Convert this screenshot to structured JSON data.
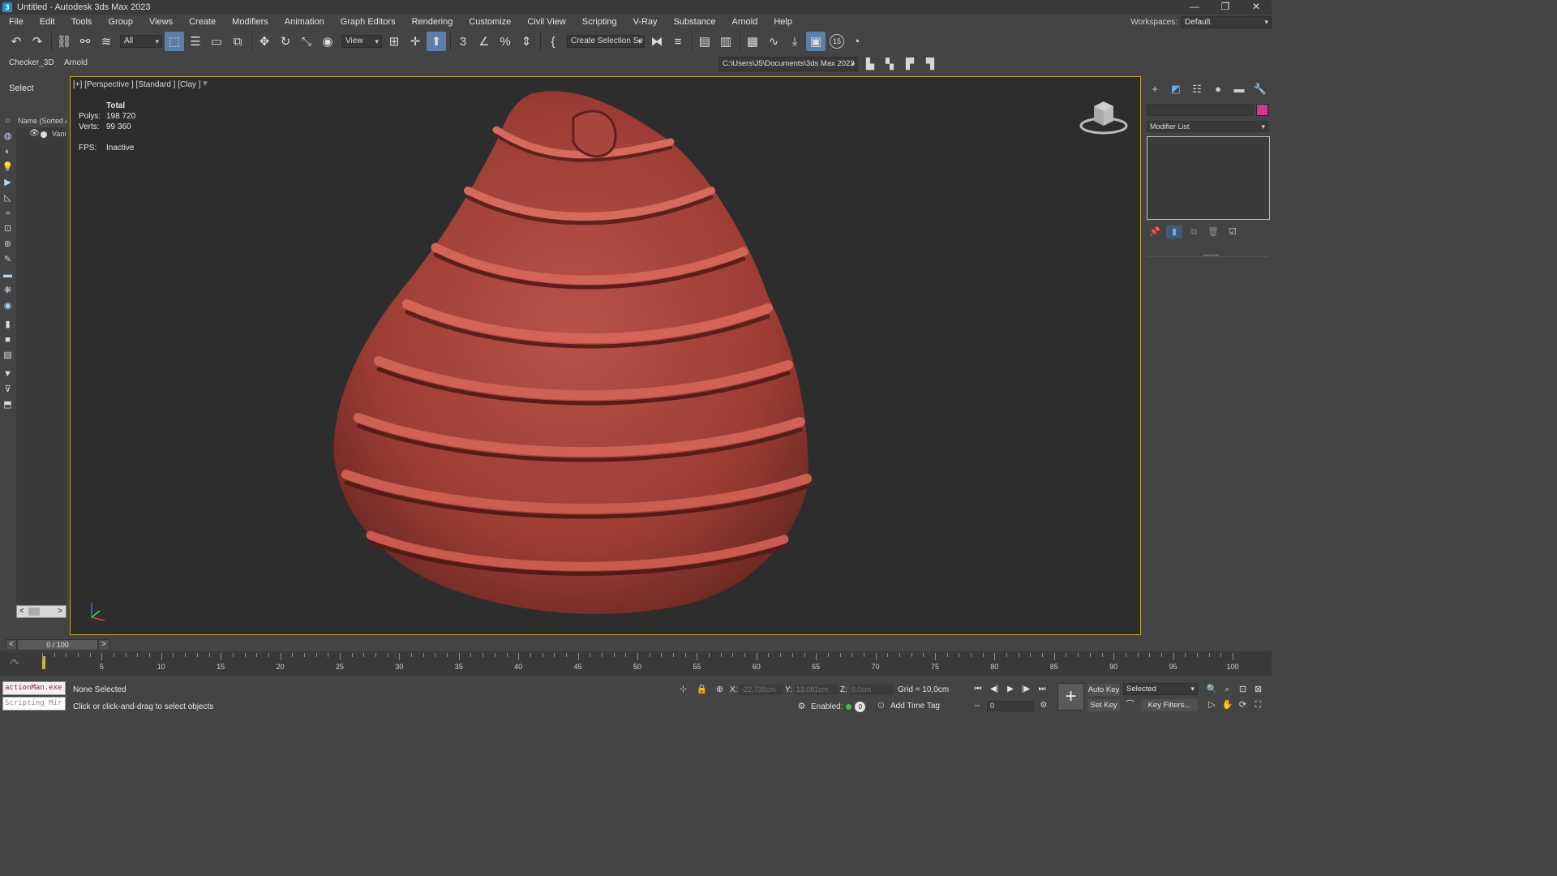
{
  "window": {
    "title": "Untitled - Autodesk 3ds Max 2023",
    "app_icon_glyph": "3",
    "controls": [
      "—",
      "❐",
      "✕"
    ]
  },
  "menubar": {
    "items": [
      "File",
      "Edit",
      "Tools",
      "Group",
      "Views",
      "Create",
      "Modifiers",
      "Animation",
      "Graph Editors",
      "Rendering",
      "Customize",
      "Civil View",
      "Scripting",
      "V-Ray",
      "Substance",
      "Arnold",
      "Help"
    ],
    "workspaces_label": "Workspaces:",
    "workspaces_value": "Default"
  },
  "toolbar": {
    "selection_filter": "All",
    "ref_coord": "View",
    "named_selection": "Create Selection Se",
    "snap_number": "3",
    "spinner_number": "15"
  },
  "ribbon": {
    "tabs": [
      "Checker_3D",
      "Arnold"
    ],
    "project_path": "C:\\Users\\J5\\Documents\\3ds Max 2023"
  },
  "scene_explorer": {
    "title": "Select",
    "column_header": "Name (Sorted A",
    "rows": [
      {
        "name": "Vani"
      }
    ],
    "scroll_left": "<",
    "scroll_right": ">"
  },
  "viewport": {
    "label": "[+] [Perspective ] [Standard ] [Clay ]",
    "stats": {
      "header": "Total",
      "polys_label": "Polys:",
      "polys_value": "198 720",
      "verts_label": "Verts:",
      "verts_value": "99 360",
      "fps_label": "FPS:",
      "fps_value": "Inactive"
    },
    "colors": {
      "border_active": "#c9a33a",
      "object": "#b24a40",
      "background": "#2d2d2d"
    }
  },
  "command_panel": {
    "modifier_list": "Modifier List",
    "object_color": "#d2378e"
  },
  "time_slider": {
    "prev": "<",
    "next": ">",
    "label": "0 / 100",
    "current_frame": 0,
    "total_frames": 100
  },
  "trackbar": {
    "ticks": [
      "5",
      "10",
      "15",
      "20",
      "25",
      "30",
      "35",
      "40",
      "45",
      "50",
      "55",
      "60",
      "65",
      "70",
      "75",
      "80",
      "85",
      "90",
      "95",
      "100"
    ]
  },
  "statusbar": {
    "maxscript_line1": "actionMan.exe",
    "maxscript_line2": "Scripting Mir",
    "selection_status": "None Selected",
    "prompt": "Click or click-and-drag to select objects",
    "x_label": "X:",
    "x_value": "-22,736cm",
    "y_label": "Y:",
    "y_value": "13,081cm",
    "z_label": "Z:",
    "z_value": "0,0cm",
    "grid": "Grid = 10,0cm",
    "enabled_label": "Enabled:",
    "enabled_badge": "0",
    "add_time_tag": "Add Time Tag",
    "frame_value": "0",
    "auto_key": "Auto Key",
    "set_key": "Set Key",
    "key_mode": "Selected",
    "key_filters": "Key Filters..."
  }
}
